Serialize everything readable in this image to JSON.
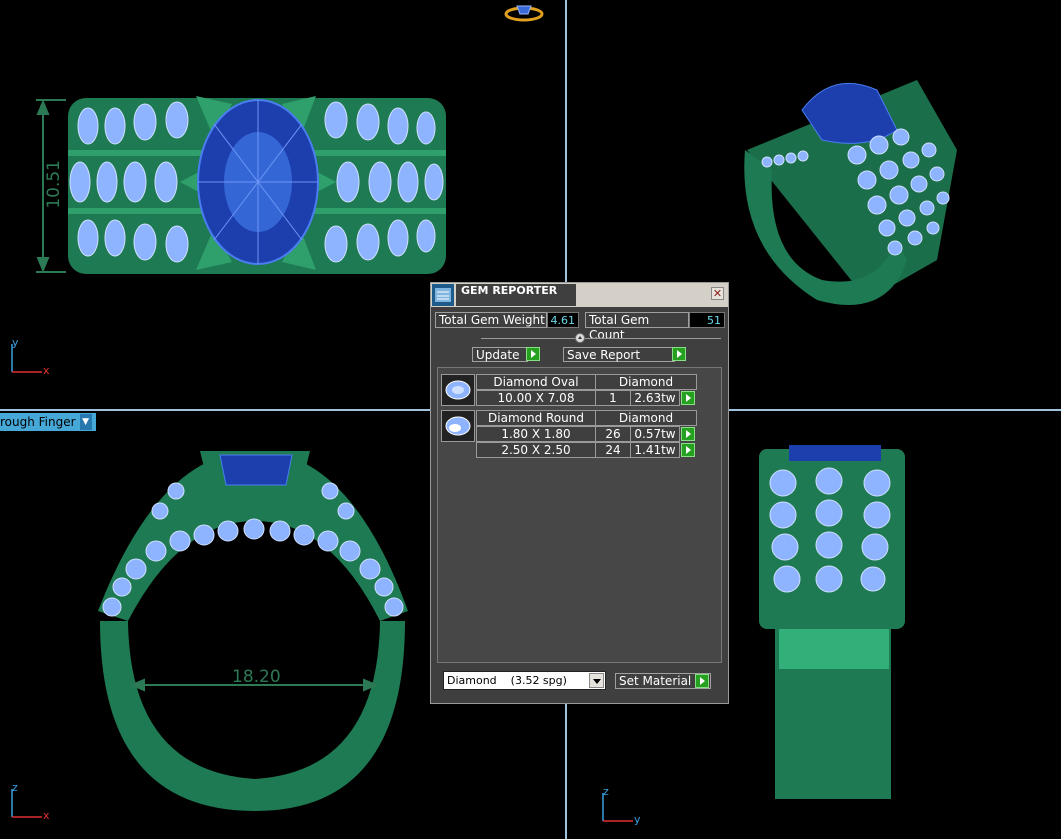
{
  "viewports": {
    "top_left": {
      "dimension": "10.51",
      "axis_v": "y",
      "axis_h": "x"
    },
    "bottom_left": {
      "dimension": "18.20",
      "axis_v": "z",
      "axis_h": "x",
      "view_mode": "rough Finger"
    },
    "bottom_right": {
      "axis_v": "z",
      "axis_h": "y"
    }
  },
  "panel": {
    "title": "GEM REPORTER",
    "total_weight_label": "Total Gem Weight",
    "total_weight_value": "4.61",
    "total_count_label": "Total Gem Count",
    "total_count_value": "51",
    "update_label": "Update",
    "save_report_label": "Save Report",
    "groups": [
      {
        "name": "Diamond Oval",
        "material": "Diamond",
        "rows": [
          {
            "size": "10.00 X 7.08",
            "count": "1",
            "weight": "2.63tw"
          }
        ]
      },
      {
        "name": "Diamond Round",
        "material": "Diamond",
        "rows": [
          {
            "size": "1.80 X 1.80",
            "count": "26",
            "weight": "0.57tw"
          },
          {
            "size": "2.50 X 2.50",
            "count": "24",
            "weight": "1.41tw"
          }
        ]
      }
    ],
    "material_select": "Diamond    (3.52 spg)",
    "set_material_label": "Set Material"
  },
  "colors": {
    "metal": "#1e7a52",
    "metal_light": "#2fa06c",
    "center_stone": "#2a56c6",
    "side_stone": "#8fb4ff",
    "divider": "#9fc3dd",
    "dim_line": "#2c7a55"
  }
}
